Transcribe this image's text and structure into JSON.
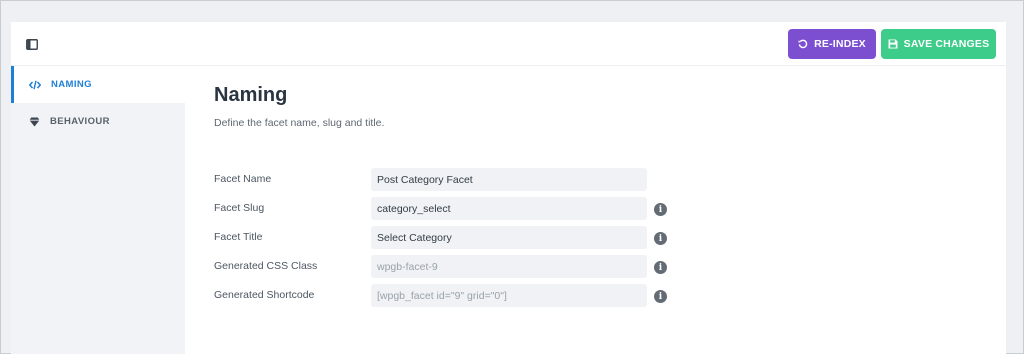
{
  "toolbar": {
    "reindex_label": "RE-INDEX",
    "save_label": "SAVE CHANGES",
    "reindex_color": "#7b4fd0",
    "save_color": "#3dcc8a",
    "toggle_icon": "sidebar-toggle-icon"
  },
  "sidebar": {
    "items": [
      {
        "label": "NAMING",
        "icon": "code-icon",
        "active": true
      },
      {
        "label": "BEHAVIOUR",
        "icon": "diamond-icon",
        "active": false
      }
    ]
  },
  "main": {
    "title": "Naming",
    "subtitle": "Define the facet name, slug and title.",
    "fields": [
      {
        "label": "Facet Name",
        "value": "Post Category Facet",
        "info": false,
        "readonly": false
      },
      {
        "label": "Facet Slug",
        "value": "category_select",
        "info": true,
        "readonly": false
      },
      {
        "label": "Facet Title",
        "value": "Select Category",
        "info": true,
        "readonly": false
      },
      {
        "label": "Generated CSS Class",
        "value": "wpgb-facet-9",
        "info": true,
        "readonly": true
      },
      {
        "label": "Generated Shortcode",
        "value": "[wpgb_facet id=\"9\" grid=\"0\"]",
        "info": true,
        "readonly": true
      }
    ],
    "info_glyph": "i"
  }
}
